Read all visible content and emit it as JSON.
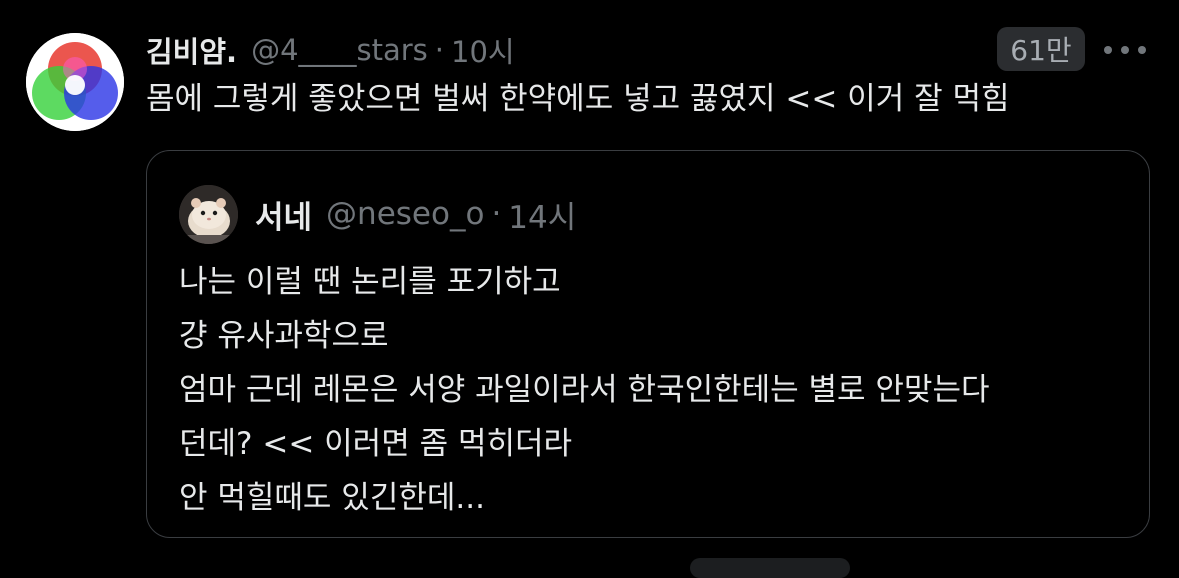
{
  "tweet": {
    "display_name": "김비얌.",
    "handle": "@4____stars",
    "separator": "·",
    "time": "10시",
    "views": "61만",
    "more_icon": "ellipsis-icon",
    "text": "몸에 그렇게 좋았으면 벌써 한약에도 넣고 끓였지 << 이거 잘 먹힘",
    "avatar_icon": "color-venn-diagram"
  },
  "quote": {
    "display_name": "서네",
    "handle": "@neseo_o",
    "separator": "·",
    "time": "14시",
    "avatar_icon": "hamster-avatar",
    "lines": [
      "나는 이럴 땐 논리를 포기하고",
      "걍 유사과학으로",
      "엄마 근데 레몬은 서양 과일이라서 한국인한테는 별로 안맞는다",
      "던데? << 이러면 좀 먹히더라",
      "안 먹힐때도 있긴한데..."
    ]
  },
  "colors": {
    "background": "#000000",
    "primary_text": "#e7e9ea",
    "secondary_text": "#71767b",
    "card_border": "#3a3d41",
    "badge_bg": "#2b2d30"
  }
}
